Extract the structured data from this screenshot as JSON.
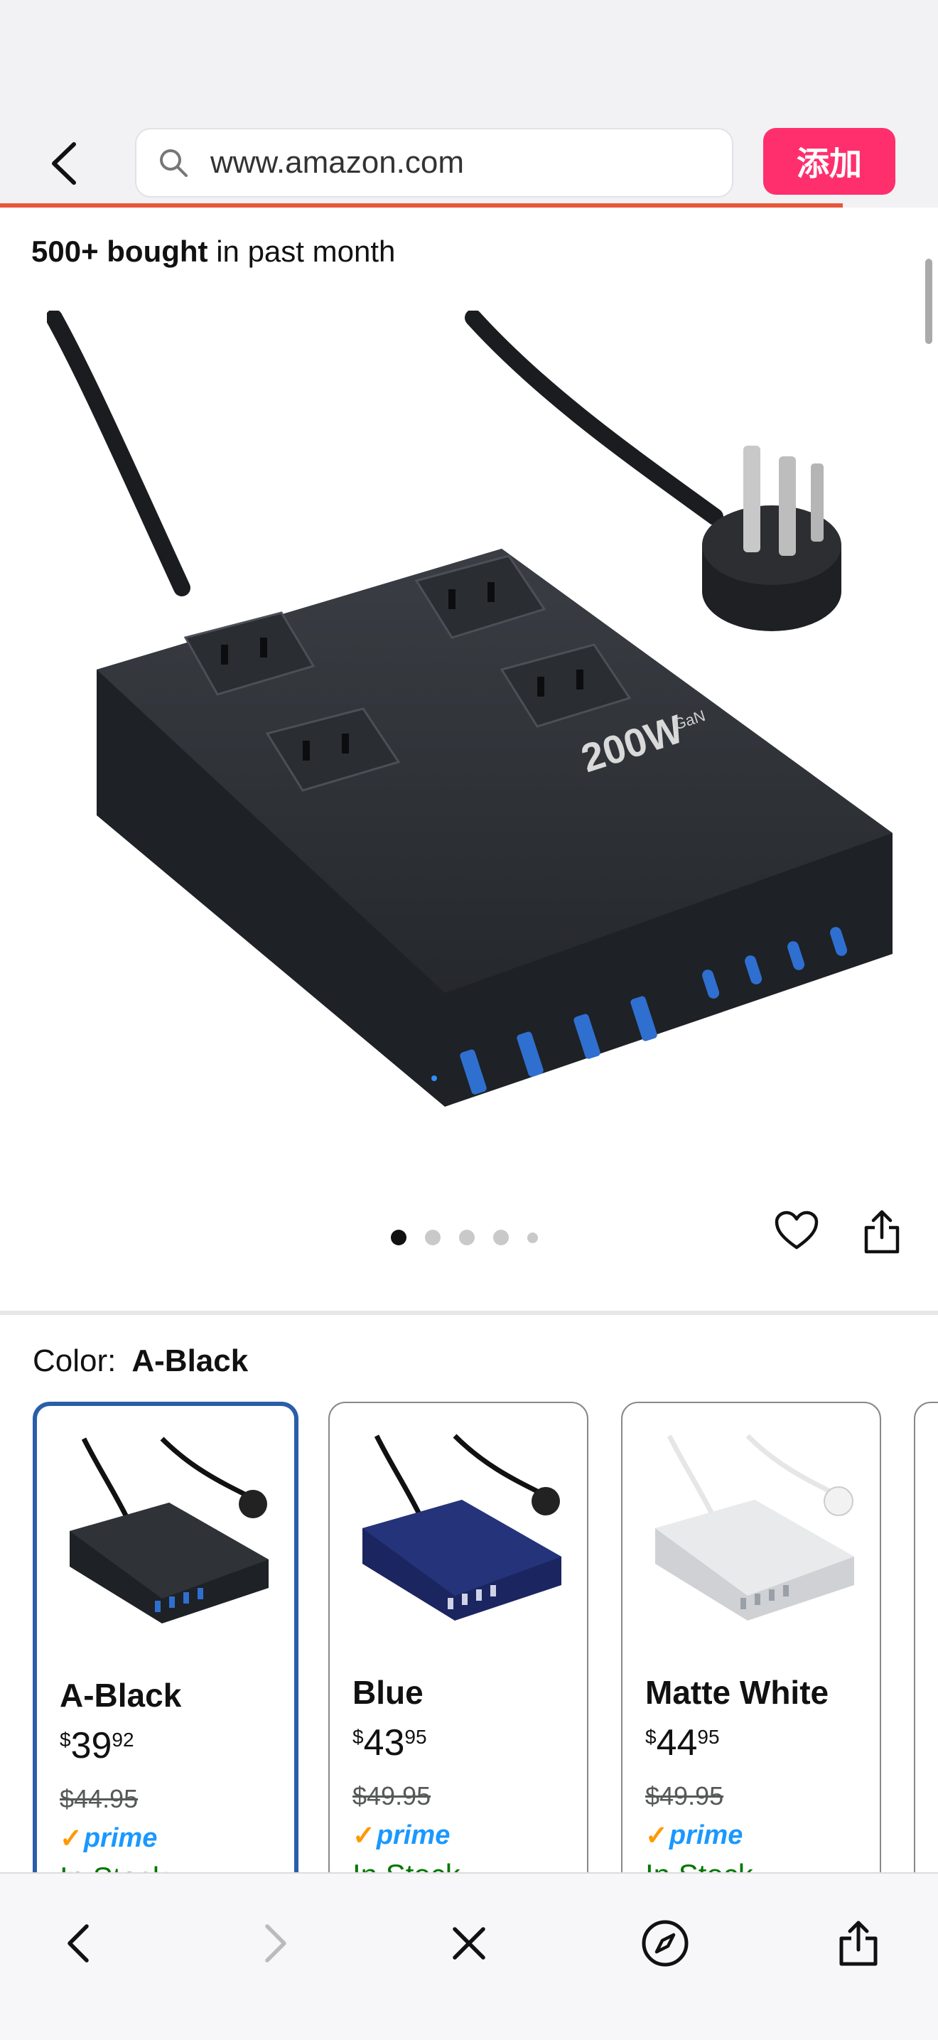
{
  "browser": {
    "url": "www.amazon.com",
    "add_label": "添加"
  },
  "product": {
    "bought_bold": "500+ bought",
    "bought_rest": " in past month",
    "image_gallery": {
      "count": 5,
      "active_index": 0
    },
    "badge_text": "200W",
    "badge_sub": "GaN"
  },
  "color_selector": {
    "label": "Color:",
    "selected": "A-Black",
    "options": [
      {
        "name": "A-Black",
        "currency": "$",
        "dollars": "39",
        "cents": "92",
        "list_price": "$44.95",
        "prime": "prime",
        "stock": "In Stock",
        "color": "#2f3338"
      },
      {
        "name": "Blue",
        "currency": "$",
        "dollars": "43",
        "cents": "95",
        "list_price": "$49.95",
        "prime": "prime",
        "stock": "In Stock",
        "color": "#25347a"
      },
      {
        "name": "Matte White",
        "currency": "$",
        "dollars": "44",
        "cents": "95",
        "list_price": "$49.95",
        "prime": "prime",
        "stock": "In Stock",
        "color": "#e9eaec"
      }
    ]
  },
  "colors": {
    "accent_add": "#ff2f6e",
    "progress": "#e8573a",
    "selected_border": "#2a5ea8",
    "prime_blue": "#1a98ff",
    "prime_check": "#ff9900",
    "in_stock": "#007600"
  },
  "icons": {
    "top_back": "chevron-left-icon",
    "search": "search-icon",
    "heart": "heart-icon",
    "share": "share-icon",
    "nav_back": "chevron-left-icon",
    "nav_forward": "chevron-right-icon",
    "close": "close-icon",
    "compass": "compass-icon",
    "toolbar_share": "share-icon"
  }
}
